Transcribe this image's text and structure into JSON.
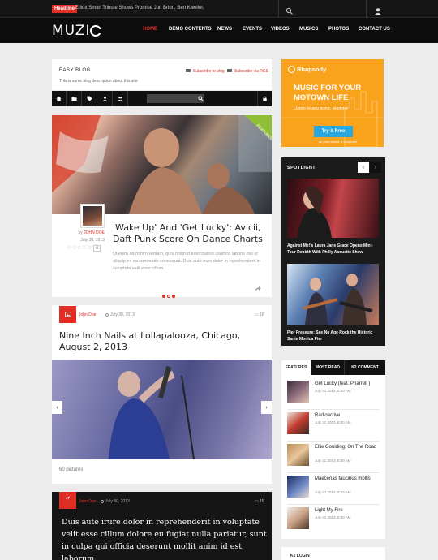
{
  "topbar": {
    "headline_label": "Headline",
    "headline_text": "Elliott Smith Tribute Shows Promise Jon Brion, Ben Kweller,"
  },
  "nav": {
    "logo": "MUZI",
    "items": [
      "HOME",
      "DEMO CONTENTS",
      "NEWS",
      "EVENTS",
      "VIDEOS",
      "MUSICS",
      "PHOTOS",
      "CONTACT US"
    ],
    "active": "HOME"
  },
  "blog": {
    "title": "EASY BLOG",
    "description": "This is some blog description about this site",
    "subscribe_blog": "Subscribe to blog",
    "subscribe_rss": "Subscribe via RSS",
    "search_placeholder": ""
  },
  "featured_post": {
    "badge": "FEATURED",
    "author_prefix": "by",
    "author": "JOHN DOE",
    "date": "July 30, 2013",
    "rating_count": "0",
    "title": "'Wake Up' And 'Get Lucky': Avicii, Daft Punk Score On Dance Charts",
    "excerpt": "Ut enim ad minim veniam, quis nostrud exercitation ullamco laboris nisi ut aliquip ex ea commodo consequat. Duis aute irure dolor in reprehenderit in voluptate velit esse cillum"
  },
  "gallery_post": {
    "author": "John Doe",
    "date": "July 30, 2013",
    "comments": "18",
    "title": "Nine Inch Nails at Lollapalooza, Chicago, August 2, 2013",
    "picture_count": "60 pictures"
  },
  "quote_post": {
    "author": "John Doe",
    "date": "July 30, 2013",
    "comments": "15",
    "text": "Duis aute irure dolor in reprehenderit in voluptate velit esse cillum dolore eu fugiat nulla pariatur, sunt in culpa qui officia deserunt mollit anim id est laborum."
  },
  "ad": {
    "brand": "Rhapsody",
    "headline_line1": "MUSIC FOR YOUR",
    "headline_line2": "MOTOWN     LIFE",
    "sub": "Listen to any song, anytime",
    "button": "Try it Free",
    "fine_print": "on your phone & computer"
  },
  "spotlight": {
    "title": "SPOTLIGHT",
    "items": [
      {
        "caption": "Against Me!'s Laura Jane Grace Opens Mini-Tour Rebirth With Philly Acoustic Show"
      },
      {
        "caption": "Pier Pressure: See No Age Rock the Historic Santa Monica Pier"
      }
    ]
  },
  "tabs": {
    "labels": [
      "FEATURES",
      "MOST READ",
      "K2 COMMENT"
    ],
    "items": [
      {
        "title": "Get Lucky (feat. Pharrell )",
        "date": "July 31 2013, 8:00 AM"
      },
      {
        "title": "Radioactive",
        "date": "July 31 2013, 8:00 AM"
      },
      {
        "title": "Ellie Goulding: On The Road",
        "date": "July 31 2013, 8:00 AM"
      },
      {
        "title": "Maecenas faucibus mollis",
        "date": "July 31 2013, 8:03 AM"
      },
      {
        "title": "Light My Fire",
        "date": "July 31 2013, 8:00 AM"
      }
    ]
  },
  "login": {
    "title": "K2 LOGIN"
  },
  "colors": {
    "accent": "#e22d22",
    "dark": "#111111",
    "ad": "#f9a21b",
    "ad_button": "#29a7de"
  }
}
